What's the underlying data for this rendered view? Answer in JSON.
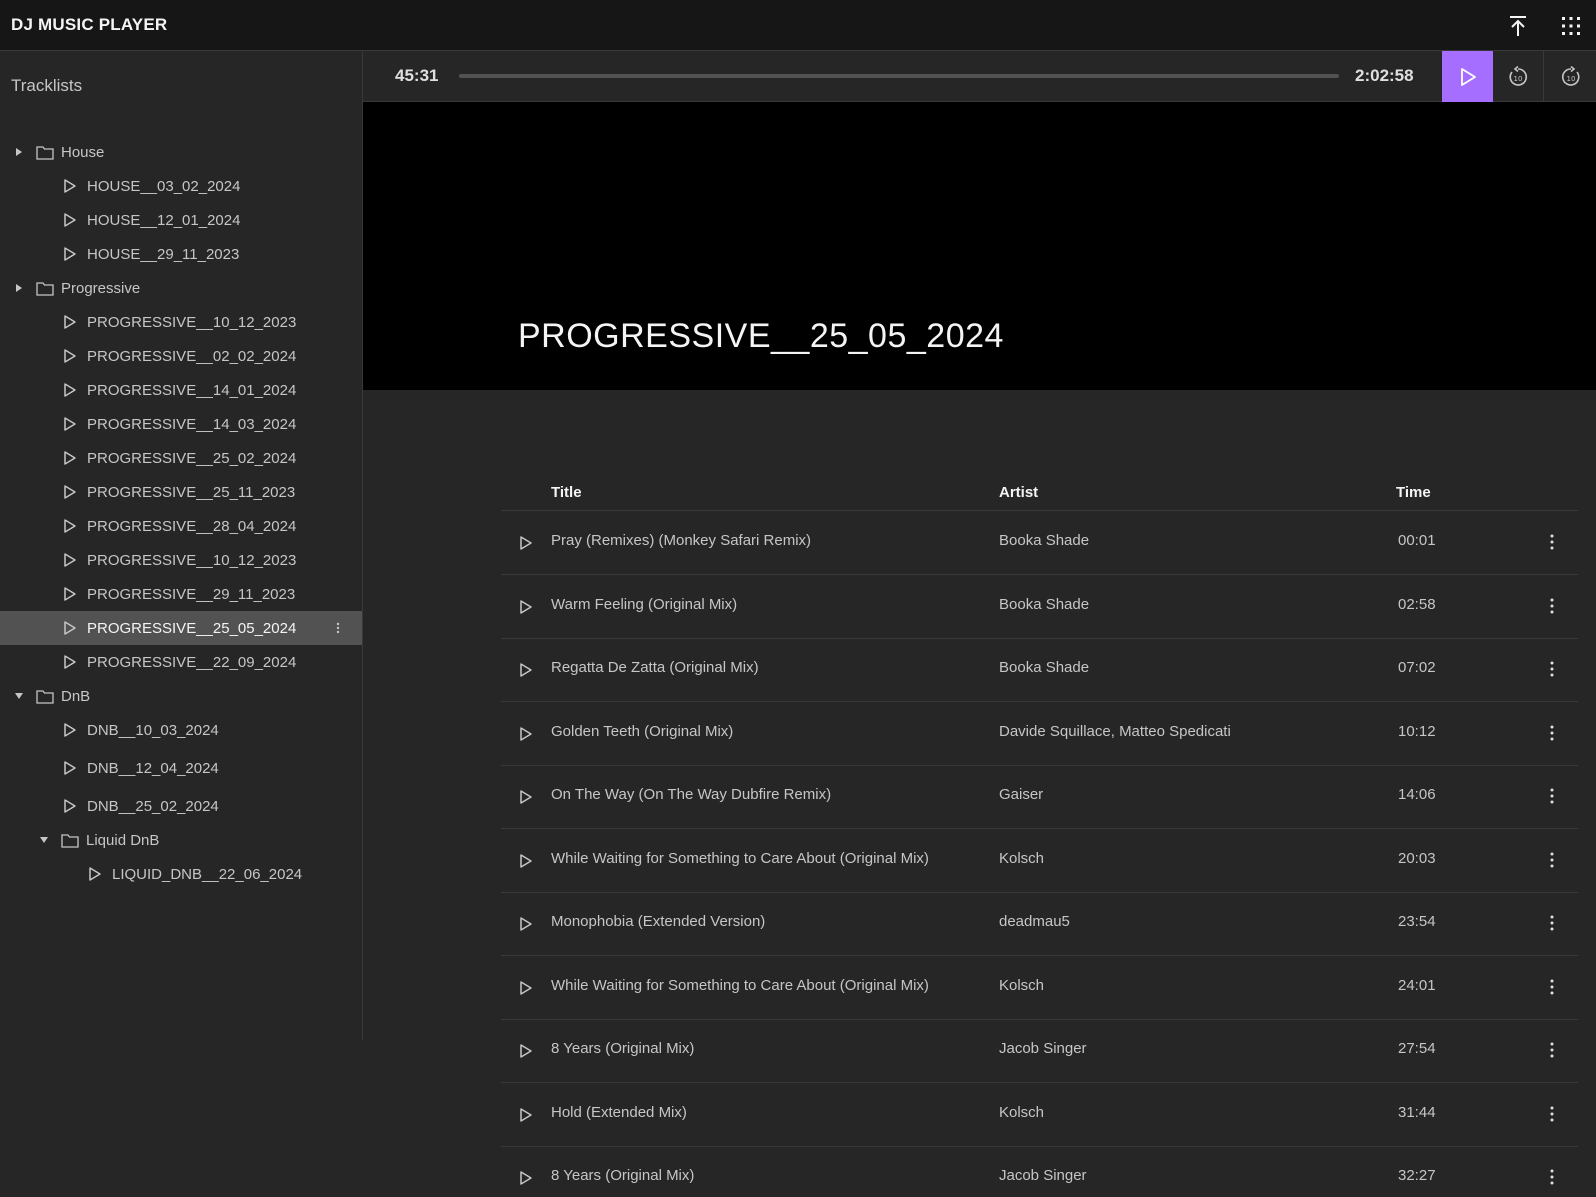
{
  "app": {
    "title": "DJ MUSIC PLAYER"
  },
  "topbar": {
    "icons": [
      "upload-icon",
      "app-grid-icon"
    ]
  },
  "sidebar": {
    "heading": "Tracklists",
    "tree": [
      {
        "type": "folder",
        "label": "House",
        "expanded": false,
        "level": 0
      },
      {
        "type": "item",
        "label": "HOUSE__03_02_2024",
        "level": 1
      },
      {
        "type": "item",
        "label": "HOUSE__12_01_2024",
        "level": 1
      },
      {
        "type": "item",
        "label": "HOUSE__29_11_2023",
        "level": 1
      },
      {
        "type": "folder",
        "label": "Progressive",
        "expanded": false,
        "level": 0
      },
      {
        "type": "item",
        "label": "PROGRESSIVE__10_12_2023",
        "level": 1
      },
      {
        "type": "item",
        "label": "PROGRESSIVE__02_02_2024",
        "level": 1
      },
      {
        "type": "item",
        "label": "PROGRESSIVE__14_01_2024",
        "level": 1
      },
      {
        "type": "item",
        "label": "PROGRESSIVE__14_03_2024",
        "level": 1
      },
      {
        "type": "item",
        "label": "PROGRESSIVE__25_02_2024",
        "level": 1
      },
      {
        "type": "item",
        "label": "PROGRESSIVE__25_11_2023",
        "level": 1
      },
      {
        "type": "item",
        "label": "PROGRESSIVE__28_04_2024",
        "level": 1
      },
      {
        "type": "item",
        "label": "PROGRESSIVE__10_12_2023",
        "level": 1
      },
      {
        "type": "item",
        "label": "PROGRESSIVE__29_11_2023",
        "level": 1
      },
      {
        "type": "item",
        "label": "PROGRESSIVE__25_05_2024",
        "level": 1,
        "selected": true
      },
      {
        "type": "item",
        "label": "PROGRESSIVE__22_09_2024",
        "level": 1
      },
      {
        "type": "folder",
        "label": "DnB",
        "expanded": true,
        "level": 0
      },
      {
        "type": "item",
        "label": "DNB__10_03_2024",
        "level": 1
      },
      {
        "type": "item",
        "label": "DNB__12_04_2024",
        "level": 1
      },
      {
        "type": "item",
        "label": "DNB__25_02_2024",
        "level": 1
      },
      {
        "type": "folder",
        "label": "Liquid DnB",
        "expanded": true,
        "level": 1
      },
      {
        "type": "item",
        "label": "LIQUID_DNB__22_06_2024",
        "level": 2
      }
    ]
  },
  "player": {
    "current_time": "45:31",
    "total_time": "2:02:58",
    "progress": 0,
    "play_icon": "play-icon",
    "back_icon": "rewind-10-icon",
    "forward_icon": "forward-10-icon",
    "accent": "#a56eff"
  },
  "hero": {
    "title": "PROGRESSIVE__25_05_2024"
  },
  "tracks": {
    "headers": {
      "title": "Title",
      "artist": "Artist",
      "time": "Time"
    },
    "rows": [
      {
        "title": "Pray (Remixes) (Monkey Safari Remix)",
        "artist": "Booka Shade",
        "time": "00:01"
      },
      {
        "title": "Warm Feeling (Original Mix)",
        "artist": "Booka Shade",
        "time": "02:58"
      },
      {
        "title": "Regatta De Zatta (Original Mix)",
        "artist": "Booka Shade",
        "time": "07:02"
      },
      {
        "title": "Golden Teeth (Original Mix)",
        "artist": "Davide Squillace, Matteo Spedicati",
        "time": "10:12"
      },
      {
        "title": "On The Way (On The Way Dubfire Remix)",
        "artist": "Gaiser",
        "time": "14:06"
      },
      {
        "title": "While Waiting for Something to Care About (Original Mix)",
        "artist": "Kolsch",
        "time": "20:03"
      },
      {
        "title": "Monophobia (Extended Version)",
        "artist": "deadmau5",
        "time": "23:54"
      },
      {
        "title": "While Waiting for Something to Care About (Original Mix)",
        "artist": "Kolsch",
        "time": "24:01"
      },
      {
        "title": "8 Years (Original Mix)",
        "artist": "Jacob Singer",
        "time": "27:54"
      },
      {
        "title": "Hold (Extended Mix)",
        "artist": "Kolsch",
        "time": "31:44"
      },
      {
        "title": "8 Years (Original Mix)",
        "artist": "Jacob Singer",
        "time": "32:27"
      }
    ]
  }
}
